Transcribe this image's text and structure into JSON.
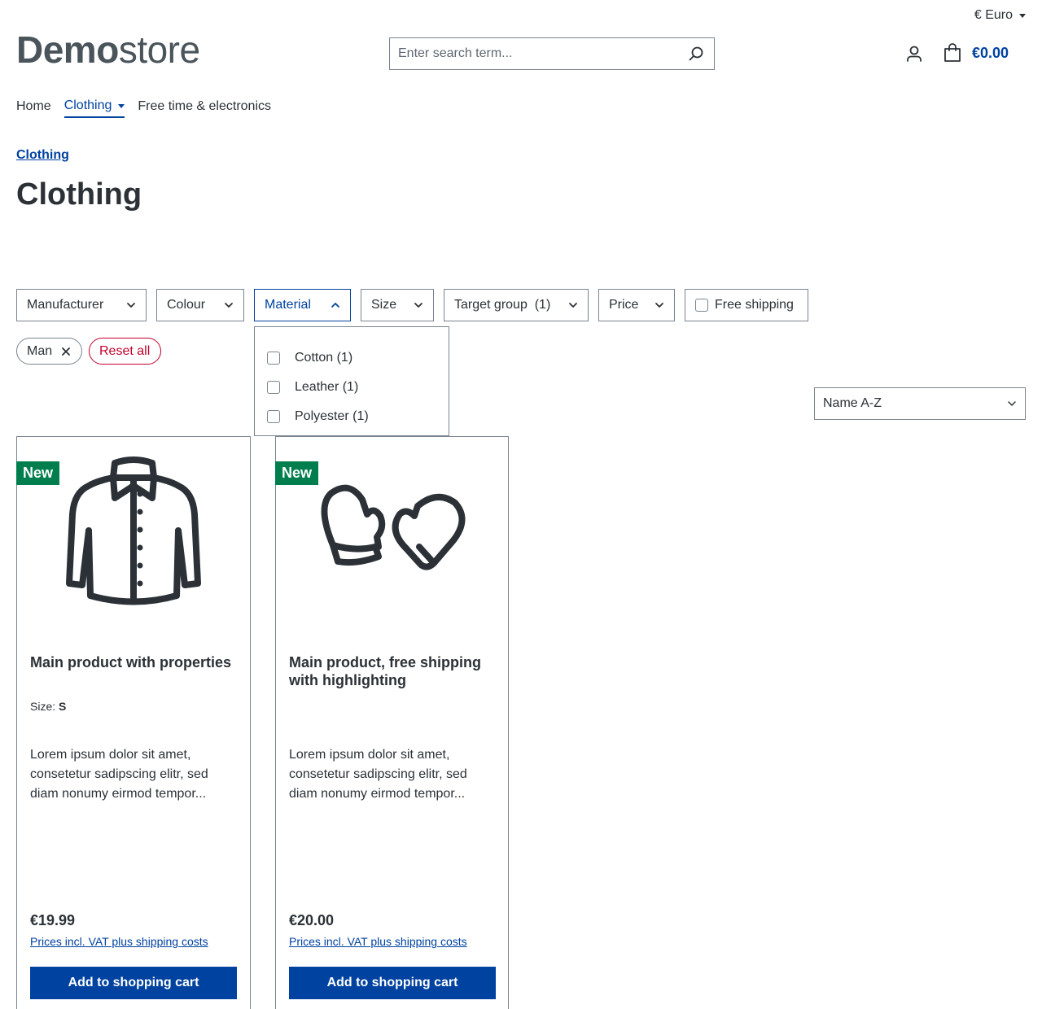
{
  "header": {
    "currency_label": "€ Euro",
    "logo_bold": "Demo",
    "logo_light": "store",
    "search_placeholder": "Enter search term...",
    "cart_total": "€0.00"
  },
  "nav": {
    "items": [
      "Home",
      "Clothing",
      "Free time & electronics"
    ]
  },
  "breadcrumb": "Clothing",
  "page_title": "Clothing",
  "filters": {
    "manufacturer": "Manufacturer",
    "colour": "Colour",
    "material": "Material",
    "size": "Size",
    "target_group": "Target group  (1)",
    "price": "Price",
    "free_shipping": "Free shipping"
  },
  "active_filters": {
    "chip": "Man",
    "reset": "Reset all"
  },
  "material_options": [
    "Cotton (1)",
    "Leather (1)",
    "Polyester (1)"
  ],
  "sort": {
    "selected": "Name A-Z"
  },
  "products": [
    {
      "badge": "New",
      "name": "Main product with properties",
      "prop_label": "Size:",
      "prop_value": "S",
      "description": "Lorem ipsum dolor sit amet, consetetur sadipscing elitr, sed diam nonumy eirmod tempor...",
      "price": "€19.99",
      "vat": "Prices incl. VAT plus shipping costs",
      "button": "Add to shopping cart"
    },
    {
      "badge": "New",
      "name": "Main product, free shipping with highlighting",
      "description": "Lorem ipsum dolor sit amet, consetetur sadipscing elitr, sed diam nonumy eirmod tempor...",
      "price": "€20.00",
      "vat": "Prices incl. VAT plus shipping costs",
      "button": "Add to shopping cart"
    }
  ],
  "colors": {
    "primary": "#0042a0",
    "badge_green": "#007e4e",
    "danger": "#c2002a"
  }
}
